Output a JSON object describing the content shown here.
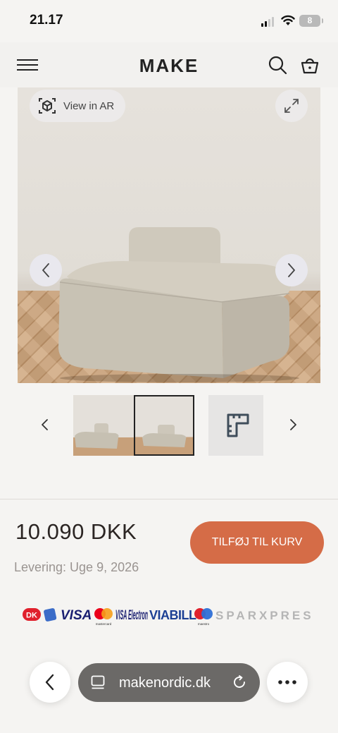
{
  "status_bar": {
    "time": "21.17",
    "battery": "8"
  },
  "header": {
    "logo": "MAKE"
  },
  "hero": {
    "ar_label": "View in AR"
  },
  "product": {
    "price": "10.090 DKK",
    "delivery": "Levering: Uge 9, 2026",
    "add_to_cart": "TILFØJ TIL KURV"
  },
  "payments": [
    "DK",
    "VISA",
    "mastercard",
    "VISA Electron",
    "VIABILL",
    "maestro",
    "SPARXPRES"
  ],
  "browser": {
    "url": "makenordic.dk"
  },
  "colors": {
    "accent": "#d56c47",
    "background": "#f5f4f2",
    "text": "#2b2523"
  },
  "icons": [
    "menu-icon",
    "search-icon",
    "basket-icon",
    "ar-cube-icon",
    "expand-icon",
    "chevron-left-icon",
    "chevron-right-icon",
    "ruler-icon",
    "tabs-icon",
    "reload-icon",
    "more-icon"
  ]
}
